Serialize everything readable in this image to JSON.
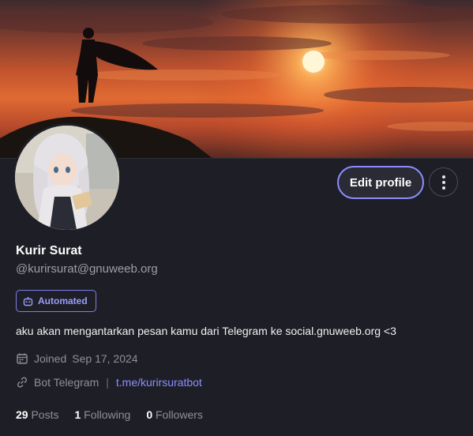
{
  "profile": {
    "display_name": "Kurir Surat",
    "handle": "@kurirsurat@gnuweeb.org",
    "badge": "Automated",
    "bio": "aku akan mengantarkan pesan kamu dari Telegram ke social.gnuweeb.org <3",
    "joined_label": "Joined",
    "joined_date": "Sep 17, 2024",
    "field_name": "Bot Telegram",
    "field_separator": "|",
    "field_value": "t.me/kurirsuratbot"
  },
  "actions": {
    "edit_label": "Edit profile",
    "more_icon": "vertical-ellipsis-icon"
  },
  "stats": {
    "posts_count": "29",
    "posts_label": "Posts",
    "following_count": "1",
    "following_label": "Following",
    "followers_count": "0",
    "followers_label": "Followers"
  },
  "icons": {
    "badge": "robot-icon",
    "joined": "calendar-icon",
    "link": "link-icon"
  },
  "colors": {
    "background": "#1e1f26",
    "accent": "#8b8dff",
    "muted": "#8e909a"
  }
}
